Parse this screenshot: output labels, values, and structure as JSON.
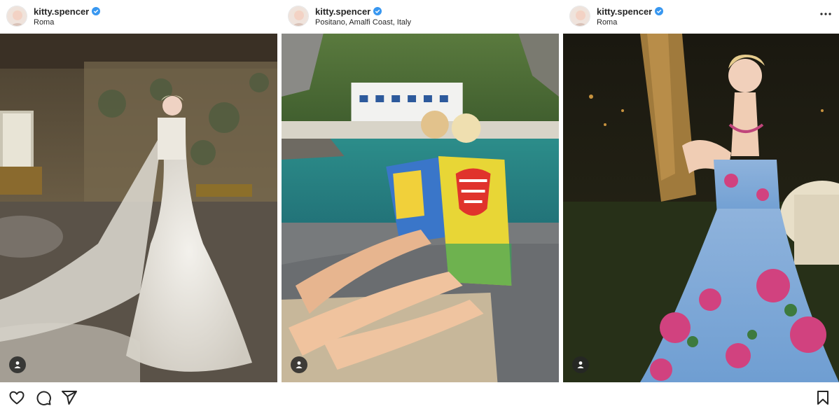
{
  "posts": [
    {
      "username": "kitty.spencer",
      "location": "Roma",
      "photo_icon": "wedding-photo",
      "tag_icon": "user-tag-icon"
    },
    {
      "username": "kitty.spencer",
      "location": "Positano, Amalfi Coast, Italy",
      "photo_icon": "boat-photo",
      "tag_icon": "user-tag-icon"
    },
    {
      "username": "kitty.spencer",
      "location": "Roma",
      "photo_icon": "dinner-photo",
      "tag_icon": "user-tag-icon"
    }
  ],
  "actions": {
    "like_icon": "heart-icon",
    "comment_icon": "comment-icon",
    "share_icon": "share-icon",
    "save_icon": "bookmark-icon"
  },
  "colors": {
    "verified": "#3897f0",
    "text": "#262626",
    "tag_bg": "#262626"
  }
}
